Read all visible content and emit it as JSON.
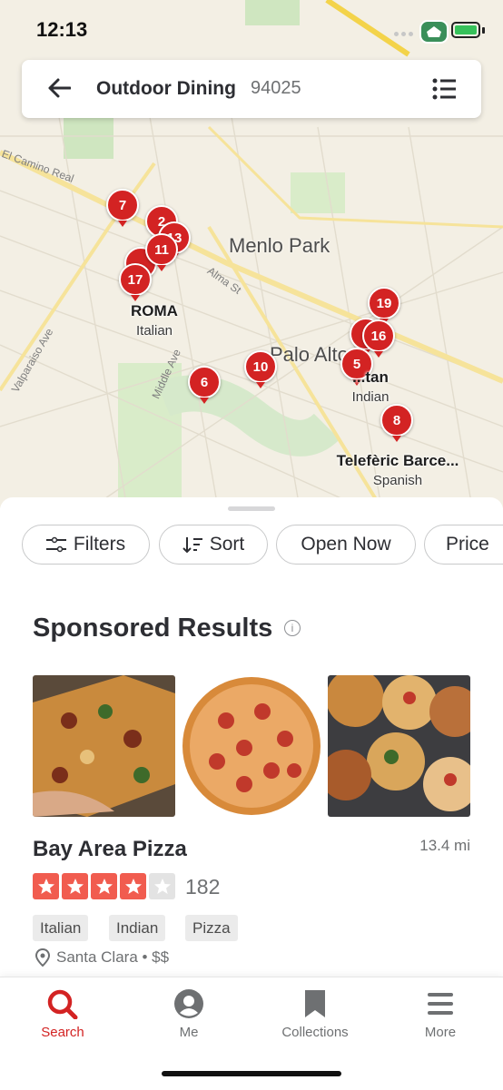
{
  "status_bar": {
    "time": "12:13"
  },
  "header": {
    "title": "Outdoor Dining",
    "zip": "94025"
  },
  "map": {
    "towns": [
      "Menlo Park",
      "Palo Alto"
    ],
    "streets": [
      "El Camino Real",
      "Alma St",
      "Valparaiso Ave",
      "Middle Ave"
    ],
    "pins": [
      "7",
      "2",
      "13",
      "11",
      "17",
      "19",
      "16",
      "5",
      "10",
      "6",
      "8"
    ],
    "labels": [
      {
        "name": "ROMA",
        "cuisine": "Italian"
      },
      {
        "name": "...tan",
        "cuisine": "Indian"
      },
      {
        "name": "Telefèric Barce...",
        "cuisine": "Spanish"
      }
    ]
  },
  "filters": {
    "filters_label": "Filters",
    "sort_label": "Sort",
    "open_now_label": "Open Now",
    "price_label": "Price"
  },
  "sponsored": {
    "heading": "Sponsored Results",
    "info_icon": "i",
    "business": {
      "name": "Bay Area Pizza",
      "distance": "13.4 mi",
      "rating": 4,
      "reviews": "182",
      "tags": [
        "Italian",
        "Indian",
        "Pizza"
      ],
      "location": "Santa Clara • $$"
    }
  },
  "tabbar": {
    "search": "Search",
    "me": "Me",
    "collections": "Collections",
    "more": "More"
  },
  "colors": {
    "accent": "#d32323",
    "star_on": "#f15c4f",
    "star_off": "#e3e3e3",
    "battery": "#36c15a"
  }
}
